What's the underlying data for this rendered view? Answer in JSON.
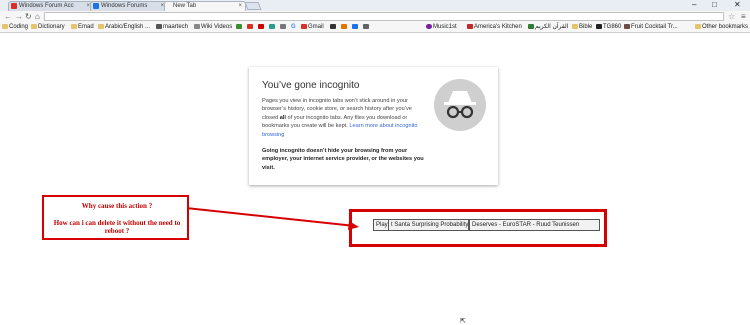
{
  "tabs": [
    {
      "label": "Windows Forum Acc",
      "active": false,
      "favicon_color": "#d93025"
    },
    {
      "label": "Windows Forums",
      "active": false,
      "favicon_color": "#1a73e8"
    },
    {
      "label": "New Tab",
      "active": true,
      "favicon_color": ""
    }
  ],
  "window_controls": {
    "minimize": "–",
    "maximize": "□",
    "close": "✕"
  },
  "toolbar": {
    "back": "←",
    "forward": "→",
    "reload": "↻",
    "home": "⌂",
    "omnibox_value": "",
    "star": "☆",
    "menu": "≡"
  },
  "bookmarks": [
    {
      "label": "Coding",
      "icon": "folder",
      "color": "#e6c56a"
    },
    {
      "label": "Dictionary",
      "icon": "folder",
      "color": "#e6c56a"
    },
    {
      "label": "Emad",
      "icon": "folder",
      "color": "#e6c56a"
    },
    {
      "label": "Arabic/English ...",
      "icon": "folder",
      "color": "#e6c56a"
    },
    {
      "label": "maartech",
      "icon": "square",
      "color": "#555555"
    },
    {
      "label": "Wiki Videos",
      "icon": "square",
      "color": "#888888"
    },
    {
      "label": "",
      "icon": "square",
      "color": "#3c8d2f"
    },
    {
      "label": "",
      "icon": "square",
      "color": "#d93025"
    },
    {
      "label": "",
      "icon": "square",
      "color": "#cc0000"
    },
    {
      "label": "",
      "icon": "square",
      "color": "#2a9d8f"
    },
    {
      "label": "",
      "icon": "square",
      "color": "#777777"
    },
    {
      "label": "G",
      "icon": "square",
      "color": "#4285f4"
    },
    {
      "label": "Gmail",
      "icon": "square",
      "color": "#d93025"
    },
    {
      "label": "",
      "icon": "square",
      "color": "#333333"
    },
    {
      "label": "",
      "icon": "square",
      "color": "#e37400"
    },
    {
      "label": "",
      "icon": "square",
      "color": "#1a73e8"
    },
    {
      "label": "",
      "icon": "square",
      "color": "#5f6368"
    },
    {
      "label": "Music1st",
      "icon": "square",
      "color": "#7b1fa2"
    },
    {
      "label": "America's Kitchen",
      "icon": "square",
      "color": "#c62828"
    },
    {
      "label": "القرآن الكريم",
      "icon": "square",
      "color": "#2e7d32"
    },
    {
      "label": "Bible",
      "icon": "folder",
      "color": "#e6c56a"
    },
    {
      "label": "TG860",
      "icon": "square",
      "color": "#222222"
    },
    {
      "label": "Fruit Cocktail Tr...",
      "icon": "square",
      "color": "#6d4c41"
    },
    {
      "label": "Other bookmarks",
      "icon": "folder",
      "color": "#e6c56a"
    }
  ],
  "incognito": {
    "title": "You’ve gone incognito",
    "body_part1": "Pages you view in incognito tabs won’t stick around in your browser’s history, cookie store, or search history after you’ve closed",
    "body_bold": "all",
    "body_part2": "of your incognito tabs. Any files you download or bookmarks you create will be kept.",
    "learn_more": "Learn more about incognito browsing",
    "warning": "Going incognito doesn’t hide your browsing from your employer, your internet service provider, or the websites you visit."
  },
  "annotation": {
    "question1": "Why cause this action ?",
    "question2": "How can i can delete it without the need to reboot ?",
    "color": "#d60000"
  },
  "leftover_buttons": [
    "Play",
    "t Santa Surprising Probability",
    "Deserves - EuroSTAR - Ruud Teunissen"
  ]
}
